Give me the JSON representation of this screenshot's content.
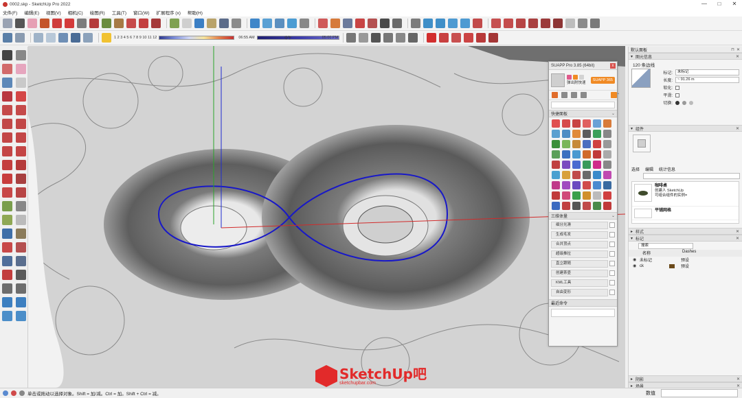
{
  "window": {
    "title": "0002.skp - SketchUp Pro 2022",
    "controls": [
      "—",
      "□",
      "✕"
    ]
  },
  "menu": [
    "文件(F)",
    "编辑(E)",
    "视图(V)",
    "相机(C)",
    "绘图(R)",
    "工具(T)",
    "窗口(W)",
    "扩展程序 (x)",
    "帮助(H)"
  ],
  "shadow_toolbar": {
    "months": [
      "1",
      "2",
      "3",
      "4",
      "5",
      "6",
      "7",
      "8",
      "9",
      "10",
      "11",
      "12"
    ],
    "time_start": "06:55 AM",
    "time_mid": "中午",
    "time_end": "05:00 PM"
  },
  "suapp": {
    "title": "SUAPP Pro 3.85 (64bit)",
    "user": "弹出附快速",
    "button": "SUAPP 365",
    "section1": "快捷面板",
    "section1_badge": "1",
    "section2": "三维体量",
    "list": [
      "细分光滑",
      "生成毛发",
      "合并顶点",
      "超级推拉",
      "直立跟随",
      "创建茶壶",
      "KML工具",
      "自由变形"
    ],
    "recent": "最近命令"
  },
  "tray": {
    "title": "默认面板",
    "entity_info": {
      "header": "图元信息",
      "entity": "120 条边线",
      "tag_label": "标记:",
      "tag_value": "未标记",
      "length_label": "长度:",
      "length_value": "~ 91.26 m",
      "soft_label": "软化:",
      "smooth_label": "平滑:",
      "toggle_label": "切换:"
    },
    "components": {
      "header": "组件",
      "tabs": [
        "选择",
        "编辑",
        "统计信息"
      ],
      "item_title": "咖啡桌",
      "item_line1": "创建人 SketchUp",
      "item_line2": "可组合组件的实例=",
      "item2_title": "平铺网格"
    },
    "styles_header": "样式",
    "tags": {
      "header": "标记",
      "search_placeholder": "搜索",
      "col_name": "名称",
      "col_dashes": "Dashes",
      "rows": [
        {
          "name": "未标记",
          "dash": "预设"
        },
        {
          "name": "ck",
          "dash": "预设"
        }
      ]
    },
    "bottom_sections": [
      "阴影",
      "场景"
    ]
  },
  "status": {
    "text": "单击或拖动以选择对象。Shift = 加/减。Ctrl = 加。Shift + Ctrl = 减。",
    "value_label": "数值"
  },
  "watermark": {
    "brand": "SketchUp吧",
    "url": "sketchupbar.com"
  },
  "colors": {
    "accent_red": "#c8362f",
    "suapp_orange": "#f08a24",
    "axis_green": "#2aa52a",
    "axis_blue": "#1e2ad0",
    "axis_red": "#d22a2a",
    "selection_blue": "#1818c8"
  }
}
